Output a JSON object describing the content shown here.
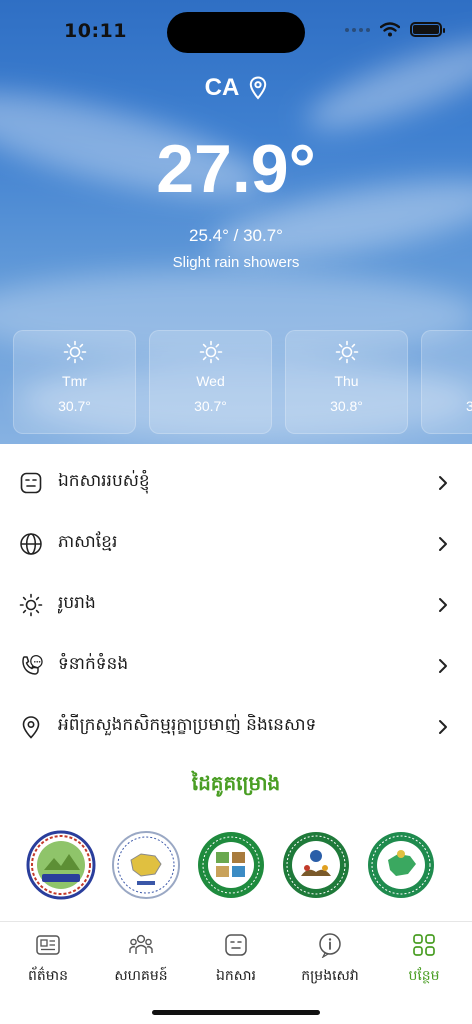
{
  "status_bar": {
    "time": "10:11"
  },
  "weather": {
    "location": "CA",
    "current_temp": "27.9°",
    "range": "25.4° / 30.7°",
    "condition": "Slight rain showers",
    "forecast": [
      {
        "day": "Tmr",
        "temp": "30.7°",
        "icon": "sun-icon"
      },
      {
        "day": "Wed",
        "temp": "30.7°",
        "icon": "sun-icon"
      },
      {
        "day": "Thu",
        "temp": "30.8°",
        "icon": "sun-icon"
      },
      {
        "day": "",
        "temp": "3",
        "icon": "sun-icon"
      }
    ]
  },
  "menu": {
    "items": [
      {
        "label": "ឯកសាររបស់ខ្ញុំ",
        "icon": "document-face-icon"
      },
      {
        "label": "ភាសាខ្មែរ",
        "icon": "globe-icon"
      },
      {
        "label": "រូបរាង",
        "icon": "sun-outline-icon"
      },
      {
        "label": "ទំនាក់ទំនង",
        "icon": "phone-chat-icon"
      },
      {
        "label": "អំពីក្រសួងកសិកម្មរុក្ខាប្រមាញ់ និងនេសាទ",
        "icon": "location-pin-icon"
      }
    ]
  },
  "partners": {
    "title": "ដៃគូគម្រោង",
    "logos": [
      "partner-logo-1",
      "partner-logo-2",
      "partner-logo-3",
      "partner-logo-4",
      "partner-logo-5"
    ]
  },
  "tabbar": {
    "items": [
      {
        "label": "ព័ត៌មាន",
        "icon": "news-icon",
        "active": false
      },
      {
        "label": "សហគមន៍",
        "icon": "community-icon",
        "active": false
      },
      {
        "label": "ឯកសារ",
        "icon": "document-icon",
        "active": false
      },
      {
        "label": "កម្រងសេវា",
        "icon": "info-icon",
        "active": false
      },
      {
        "label": "បន្ថែម",
        "icon": "grid-icon",
        "active": true
      }
    ]
  },
  "colors": {
    "accent": "#4a9e24",
    "sky": "#3f80d0"
  }
}
